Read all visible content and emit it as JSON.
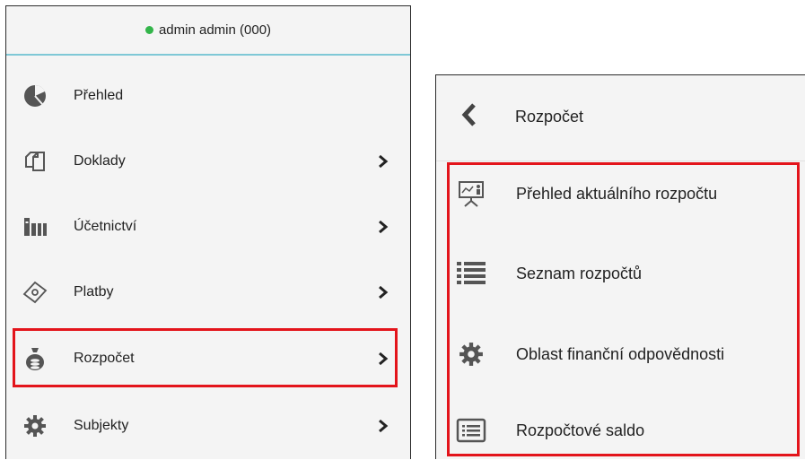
{
  "user": {
    "name": "admin admin (000)",
    "status_color": "#33b54a"
  },
  "colors": {
    "highlight": "#e3141b",
    "accent_line": "#7fc8d6",
    "icon": "#555555"
  },
  "main_menu": [
    {
      "label": "Přehled",
      "icon": "pie-chart-icon",
      "has_submenu": false
    },
    {
      "label": "Doklady",
      "icon": "documents-icon",
      "has_submenu": true
    },
    {
      "label": "Účetnictví",
      "icon": "books-icon",
      "has_submenu": true
    },
    {
      "label": "Platby",
      "icon": "banknote-icon",
      "has_submenu": true
    },
    {
      "label": "Rozpočet",
      "icon": "money-bag-icon",
      "has_submenu": true,
      "highlighted": true
    },
    {
      "label": "Subjekty",
      "icon": "gear-icon",
      "has_submenu": true
    }
  ],
  "submenu": {
    "title": "Rozpočet",
    "back_icon": "chevron-left-icon",
    "items": [
      {
        "label": "Přehled aktuálního rozpočtu",
        "icon": "presentation-icon"
      },
      {
        "label": "Seznam rozpočtů",
        "icon": "list-icon"
      },
      {
        "label": "Oblast finanční odpovědnosti",
        "icon": "gear-icon"
      },
      {
        "label": "Rozpočtové saldo",
        "icon": "card-list-icon"
      }
    ]
  }
}
